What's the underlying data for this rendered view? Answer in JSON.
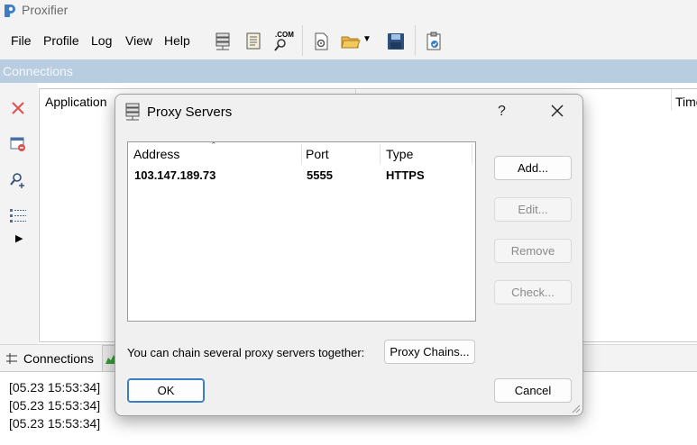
{
  "app": {
    "title": "Proxifier"
  },
  "menu": {
    "items": [
      "File",
      "Profile",
      "Log",
      "View",
      "Help"
    ]
  },
  "toolbar": {
    "icons": [
      "proxy-servers-icon",
      "proxification-rules-icon",
      "name-resolution-icon",
      "advanced-settings-icon",
      "open-profile-icon",
      "save-profile-icon",
      "system-check-icon"
    ],
    "com_label": ".COM"
  },
  "connections": {
    "header": "Connections",
    "columns": {
      "application": "Application",
      "time": "Time"
    }
  },
  "tabs": {
    "connections": "Connections"
  },
  "log": {
    "lines": [
      "[05.23 15:53:34]",
      "[05.23 15:53:34]",
      "[05.23 15:53:34]"
    ]
  },
  "dialog": {
    "title": "Proxy Servers",
    "help": "?",
    "columns": {
      "address": "Address",
      "port": "Port",
      "type": "Type"
    },
    "servers": [
      {
        "address": "103.147.189.73",
        "port": "5555",
        "type": "HTTPS"
      }
    ],
    "buttons": {
      "add": "Add...",
      "edit": "Edit...",
      "remove": "Remove",
      "check": "Check...",
      "proxy_chains": "Proxy Chains...",
      "ok": "OK",
      "cancel": "Cancel"
    },
    "chain_text": "You can chain several proxy servers together:"
  },
  "colors": {
    "accent": "#3b7cc6",
    "header_bar": "#b9cde0"
  }
}
